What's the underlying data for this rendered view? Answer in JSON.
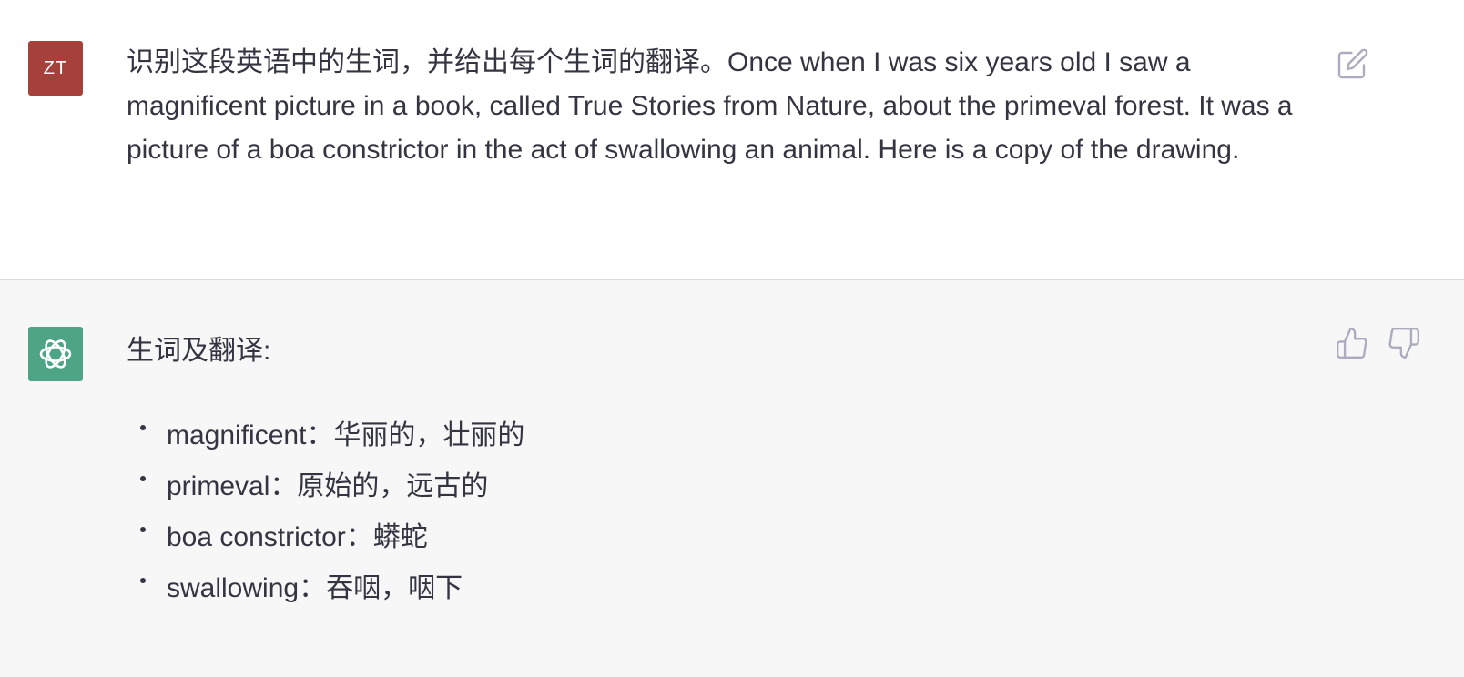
{
  "user": {
    "avatar_initials": "ZT",
    "avatar_color": "#a5413a",
    "message": "识别这段英语中的生词，并给出每个生词的翻译。Once when I was six years old I saw a magnificent picture in a book, called True Stories from Nature, about the primeval forest. It was a picture of a boa constrictor in the act of swallowing an animal. Here is a copy of the drawing.",
    "edit_icon": "edit-icon"
  },
  "assistant": {
    "avatar_icon": "openai-logo-icon",
    "avatar_color": "#4ea585",
    "heading": "生词及翻译:",
    "items": [
      {
        "term": "magnificent",
        "translation": "华丽的，壮丽的"
      },
      {
        "term": "primeval",
        "translation": "原始的，远古的"
      },
      {
        "term": "boa constrictor",
        "translation": "蟒蛇"
      },
      {
        "term": "swallowing",
        "translation": "吞咽，咽下"
      }
    ],
    "separator": "：",
    "feedback_icons": [
      "thumbs-up-icon",
      "thumbs-down-icon"
    ]
  },
  "colors": {
    "user_bg": "#ffffff",
    "assistant_bg": "#f7f7f8",
    "text": "#343541",
    "icon": "#acacbe"
  }
}
